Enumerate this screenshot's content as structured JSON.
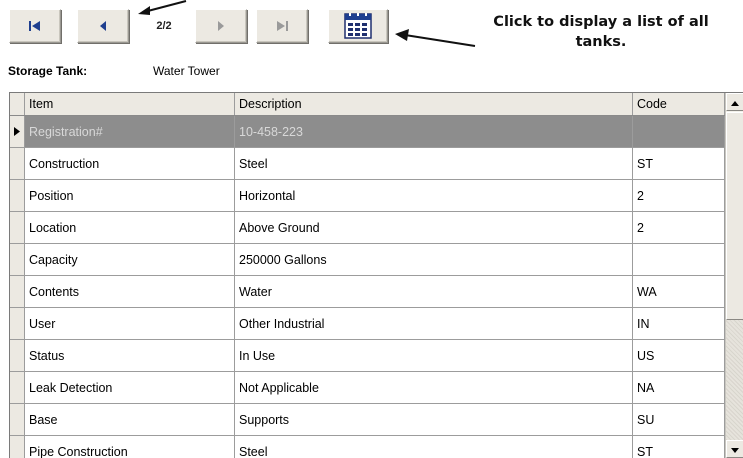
{
  "toolbar": {
    "first_icon": "skip-to-first-icon",
    "prev_icon": "previous-icon",
    "next_icon": "next-icon",
    "last_icon": "skip-to-last-icon",
    "list_icon": "list-calendar-icon",
    "record_counter": "2/2"
  },
  "annotation": {
    "text": "Click to display a list of all tanks.",
    "arrow_icon": "annotation-arrow-icon"
  },
  "storage_tank": {
    "label": "Storage Tank:",
    "value": "Water Tower"
  },
  "grid": {
    "columns": [
      "Item",
      "Description",
      "Code"
    ],
    "rows": [
      {
        "item": "Registration#",
        "description": "10-458-223",
        "code": "",
        "selected": true
      },
      {
        "item": "Construction",
        "description": "Steel",
        "code": "ST"
      },
      {
        "item": "Position",
        "description": "Horizontal",
        "code": "2"
      },
      {
        "item": "Location",
        "description": "Above Ground",
        "code": "2"
      },
      {
        "item": "Capacity",
        "description": "250000 Gallons",
        "code": ""
      },
      {
        "item": "Contents",
        "description": "Water",
        "code": "WA"
      },
      {
        "item": "User",
        "description": "Other Industrial",
        "code": "IN"
      },
      {
        "item": "Status",
        "description": "In Use",
        "code": "US"
      },
      {
        "item": "Leak Detection",
        "description": "Not Applicable",
        "code": "NA"
      },
      {
        "item": "Base",
        "description": "Supports",
        "code": "SU"
      },
      {
        "item": "Pipe Construction",
        "description": "Steel",
        "code": "ST"
      }
    ]
  },
  "colors": {
    "accent_icon": "#1f3f8f",
    "selected_row": "#8d8d8d",
    "button_face": "#ece9e2"
  }
}
